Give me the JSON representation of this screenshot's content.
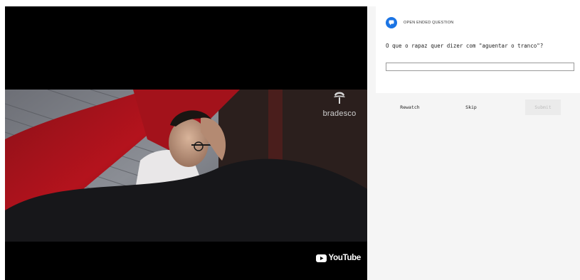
{
  "video": {
    "brand_text": "bradesco",
    "platform_text": "YouTube"
  },
  "question": {
    "type_label": "OPEN ENDED QUESTION",
    "text": "O que o rapaz quer dizer com \"aguentar o tranco\"?",
    "answer_value": "",
    "icon": "chat-bubble-icon"
  },
  "actions": {
    "rewatch_label": "Rewatch",
    "skip_label": "Skip",
    "submit_label": "Submit"
  },
  "colors": {
    "accent": "#1b74e4",
    "panel_bg": "#f5f5f5",
    "video_bg": "#000000"
  }
}
